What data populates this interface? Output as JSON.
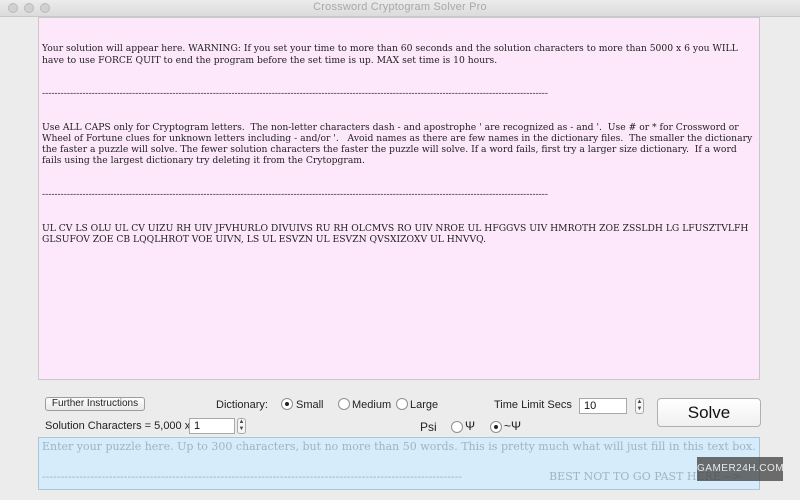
{
  "window": {
    "title": "Crossword Cryptogram Solver Pro"
  },
  "output": {
    "line1": "Your solution will appear here. WARNING: If you set your time to more than 60 seconds and the solution characters to more than 5000 x 6 you WILL have to use FORCE QUIT to end the program before the set time is up. MAX set time is 10 hours.",
    "separator1": "-------------------------------------------------------------------------------------------------------------------------------------------------------------------",
    "instructions": "Use ALL CAPS only for Cryptogram letters.  The non-letter characters dash - and apostrophe ' are recognized as - and '.  Use # or * for Crossword or Wheel of Fortune clues for unknown letters including - and/or '.   Avoid names as there are few names in the dictionary files.  The smaller the dictionary the faster a puzzle will solve. The fewer solution characters the faster the puzzle will solve. If a word fails, first try a larger size dictionary.  If a word fails using the largest dictionary try deleting it from the Crytopgram.",
    "separator2": "-------------------------------------------------------------------------------------------------------------------------------------------------------------------",
    "cryptogram": "UL CV LS OLU UL CV UIZU RH UIV JFVHURLO DIVUIVS RU RH OLCMVS RO UIV NROE UL HFGGVS UIV HMROTH ZOE ZSSLDH LG LFUSZTVLFH GLSUFOV ZOE CB LQQLHROT VOE UIVN, LS UL ESVZN UL ESVZN QVSXIZOXV UL HNVVQ."
  },
  "controls": {
    "further_instructions_label": "Further Instructions",
    "dictionary_label": "Dictionary:",
    "dictionary_options": [
      "Small",
      "Medium",
      "Large"
    ],
    "dictionary_selected": "Small",
    "time_limit_label": "Time Limit Secs",
    "time_limit_value": "10",
    "solution_chars_label": "Solution Characters = 5,000 x",
    "solution_chars_value": "1",
    "psi_label": "Psi",
    "psi_option": "Ψ",
    "not_psi_option": "~Ψ",
    "psi_selected": "~Ψ",
    "solve_label": "Solve"
  },
  "input": {
    "placeholder": "Enter your puzzle here.  Up to 300 characters, but no more than 50 words. This is pretty much what will just fill in this text box.",
    "dash_line": "-----------------------------------------------------------------------------------------------------------------",
    "end_marker": "BEST NOT TO GO PAST HERE -->"
  },
  "watermark": {
    "text": "GAMER24H.COM"
  },
  "colors": {
    "output_bg": "#fde8fb",
    "input_bg": "#d7ecfb"
  }
}
